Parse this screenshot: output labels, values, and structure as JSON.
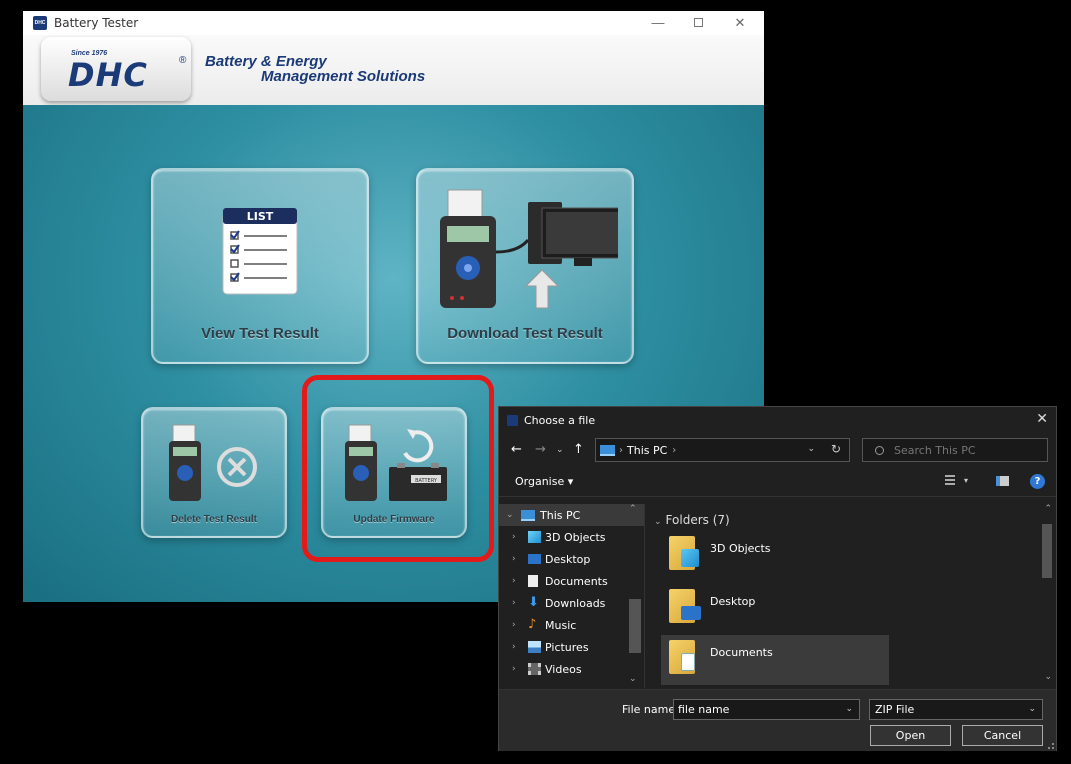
{
  "app": {
    "title": "Battery Tester",
    "controls": {
      "minimize": "—",
      "close": "✕"
    },
    "logo": {
      "since": "Since 1976",
      "brand": "DHC",
      "registered": "®"
    },
    "tagline": {
      "line1": "Battery & Energy",
      "line2": "Management Solutions"
    },
    "tiles": {
      "view": {
        "label": "View Test Result",
        "icon": "list-checklist-icon",
        "icon_text": "LIST"
      },
      "download": {
        "label": "Download Test Result",
        "icon": "tester-to-pc-icon"
      },
      "delete": {
        "label": "Delete Test Result",
        "icon": "tester-delete-icon"
      },
      "update": {
        "label": "Update Firmware",
        "icon": "tester-battery-sync-icon",
        "battery_text": "BATTERY"
      }
    },
    "highlight_color": "#e21a1a"
  },
  "dialog": {
    "title": "Choose a file",
    "close": "✕",
    "nav": {
      "back": "←",
      "forward": "→",
      "recent": "⌄",
      "up": "↑"
    },
    "address": {
      "location": "This PC",
      "sep": "›",
      "refresh": "↻"
    },
    "search": {
      "placeholder": "Search This PC"
    },
    "command": {
      "organise": "Organise ▾",
      "view_dropdown": "▾",
      "help": "?"
    },
    "nav_pane": {
      "root": {
        "label": "This PC",
        "chev": "⌄"
      },
      "items": [
        {
          "label": "3D Objects",
          "chev": "›",
          "icon": "cube-icon"
        },
        {
          "label": "Desktop",
          "chev": "›",
          "icon": "desktop-icon"
        },
        {
          "label": "Documents",
          "chev": "›",
          "icon": "document-icon"
        },
        {
          "label": "Downloads",
          "chev": "›",
          "icon": "download-arrow-icon"
        },
        {
          "label": "Music",
          "chev": "›",
          "icon": "music-note-icon"
        },
        {
          "label": "Pictures",
          "chev": "›",
          "icon": "picture-icon"
        },
        {
          "label": "Videos",
          "chev": "›",
          "icon": "film-icon"
        }
      ]
    },
    "content": {
      "group_header": "Folders (7)",
      "group_chev": "⌄",
      "folders": [
        {
          "label": "3D Objects"
        },
        {
          "label": "Desktop"
        },
        {
          "label": "Documents"
        }
      ]
    },
    "bottom": {
      "filename_label": "File name:",
      "filename_value": "file name",
      "filetype_value": "ZIP File",
      "dropdown": "⌄",
      "open_label": "Open",
      "cancel_label": "Cancel"
    },
    "scroll": {
      "up": "⌃",
      "down": "⌄"
    }
  }
}
